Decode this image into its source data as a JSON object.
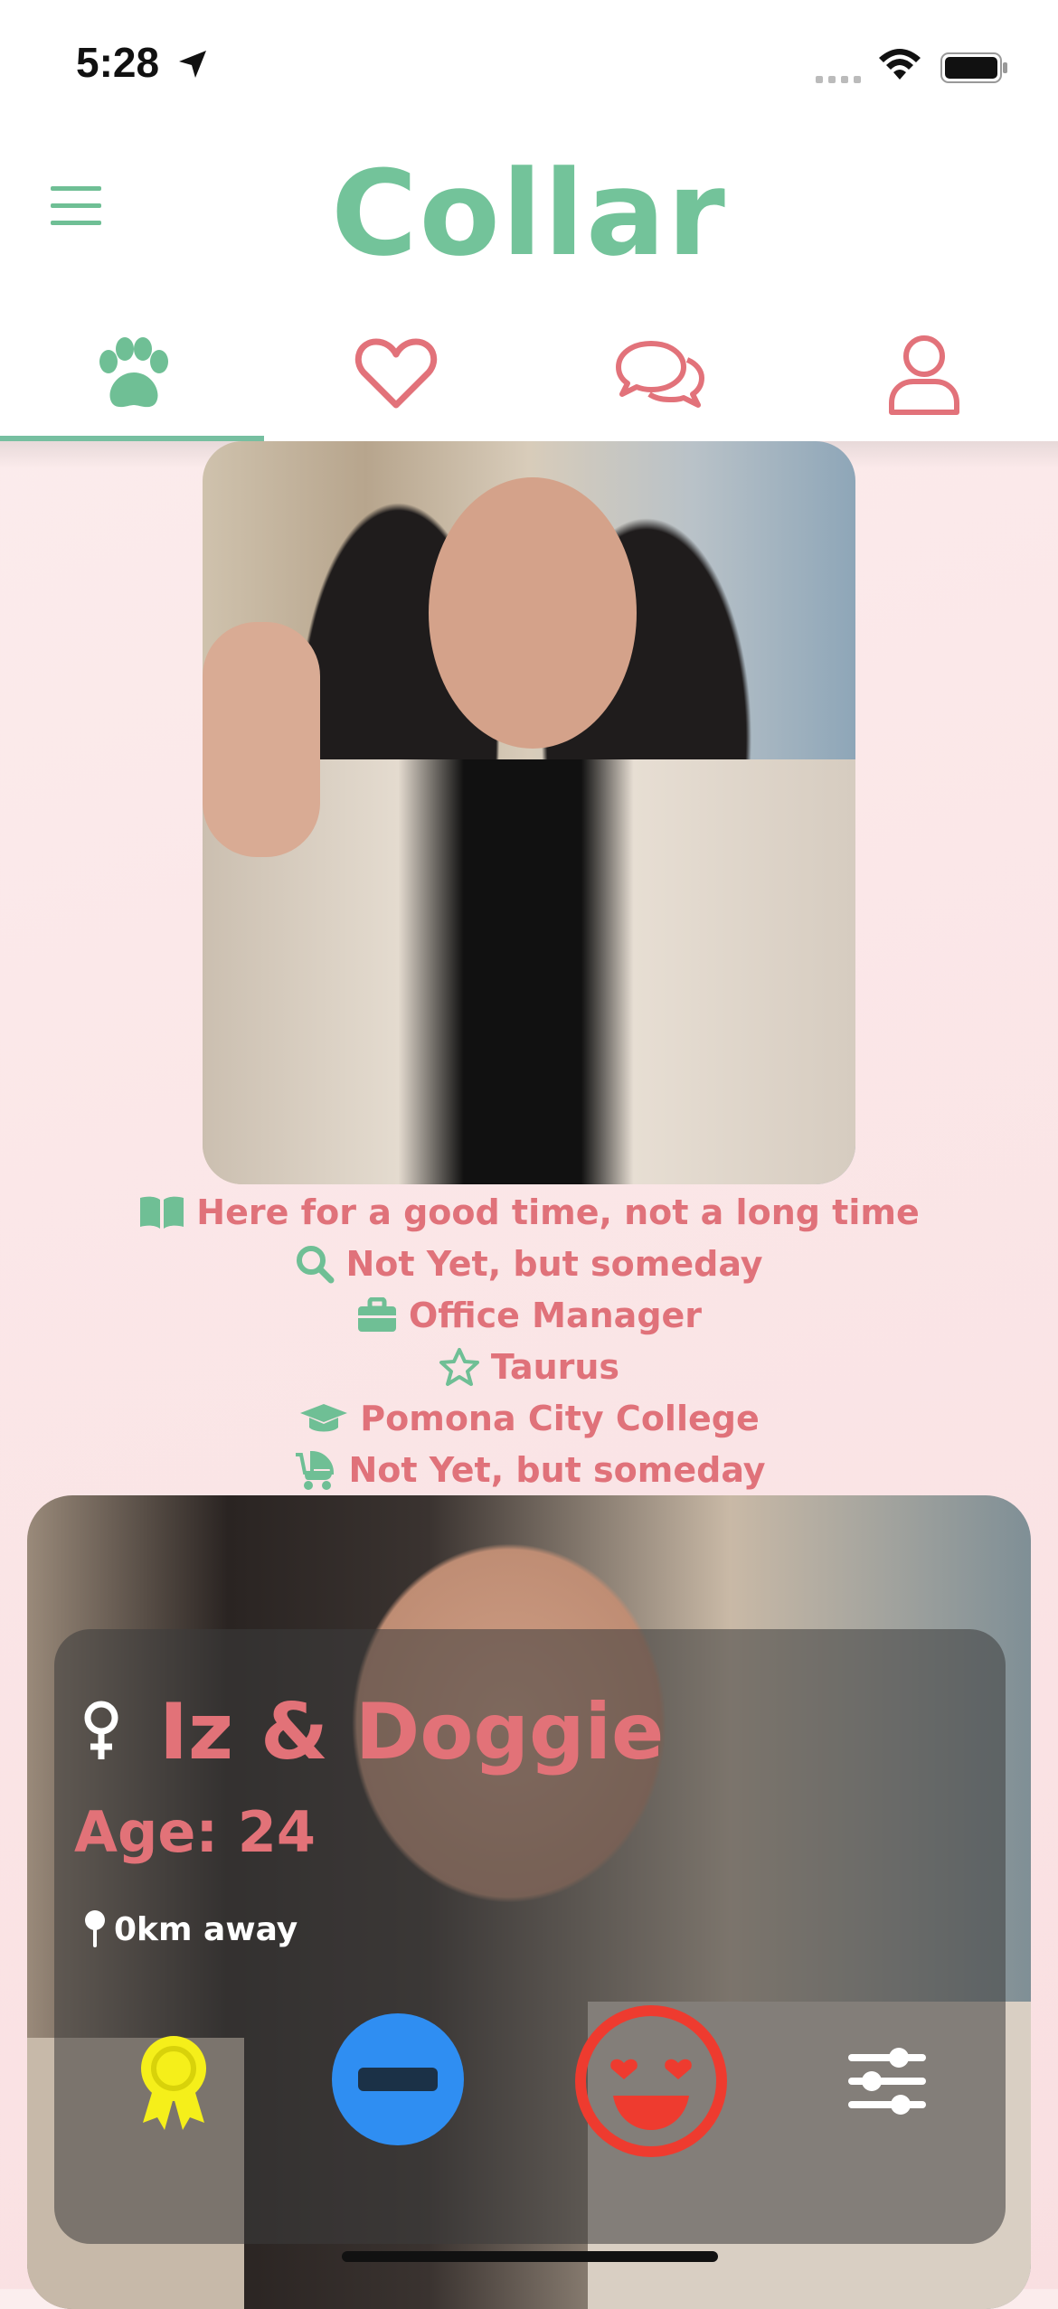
{
  "status_bar": {
    "time": "5:28"
  },
  "header": {
    "logo": "Collar"
  },
  "tabs": [
    {
      "name": "paw-icon",
      "active": true
    },
    {
      "name": "heart-icon",
      "active": false
    },
    {
      "name": "chat-icon",
      "active": false
    },
    {
      "name": "profile-icon",
      "active": false
    }
  ],
  "profile": {
    "facts": [
      {
        "icon": "book-open-icon",
        "text": "Here for a good time, not a long time"
      },
      {
        "icon": "search-icon",
        "text": "Not Yet, but someday"
      },
      {
        "icon": "briefcase-icon",
        "text": "Office Manager"
      },
      {
        "icon": "star-icon",
        "text": "Taurus"
      },
      {
        "icon": "graduation-cap-icon",
        "text": "Pomona City College"
      },
      {
        "icon": "baby-carriage-icon",
        "text": "Not Yet, but someday"
      }
    ],
    "name": "Iz & Doggie",
    "age": "Age: 24",
    "distance": "0km away",
    "gender_icon": "female-icon"
  },
  "actions": [
    {
      "name": "award-icon",
      "color": "#f5ef1a"
    },
    {
      "name": "pass-icon",
      "color": "#2f8ef2"
    },
    {
      "name": "like-icon",
      "color": "#ee3b2f"
    },
    {
      "name": "filters-icon",
      "color": "#ffffff"
    }
  ],
  "colors": {
    "brand_green": "#73c39a",
    "accent_pink": "#e0727a"
  }
}
